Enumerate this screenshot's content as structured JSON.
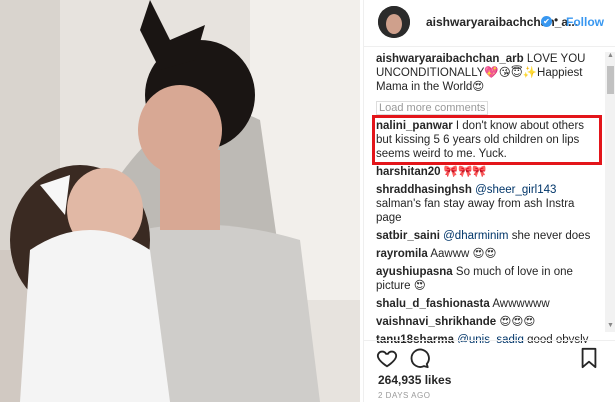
{
  "header": {
    "username": "aishwaryaraibachchan_a...",
    "separator": "•",
    "follow_label": "Follow"
  },
  "comments": [
    {
      "user": "aishwaryaraibachchan_arb",
      "text": "LOVE YOU UNCONDITIONALLY💖😘😇✨Happiest Mama in the World😍"
    },
    {
      "user": "nalini_panwar",
      "text": "I don't know about others but kissing 5 6 years old children on lips seems weird to me. Yuck."
    },
    {
      "user": "harshitan20",
      "text": "🎀🎀🎀"
    },
    {
      "user": "shraddhasinghsh",
      "mention": "@sheer_girl143",
      "text": "salman's fan stay away from ash Instra page"
    },
    {
      "user": "satbir_saini",
      "mention": "@dharminim",
      "text": "she never does"
    },
    {
      "user": "rayromila",
      "text": "Aawww 😍😍"
    },
    {
      "user": "ayushiupasna",
      "text": "So much of love in one picture 😍"
    },
    {
      "user": "shalu_d_fashionasta",
      "text": "Awwwwww"
    },
    {
      "user": "vaishnavi_shrikhande",
      "text": "😍😍😍"
    },
    {
      "user": "tanu18sharma",
      "mention": "@unis_sadiq",
      "text": "good obvsly"
    }
  ],
  "load_more": "Load more comments",
  "likes": "264,935 likes",
  "time_ago": "2 DAYS AGO",
  "icons": [
    "heart-icon",
    "comment-icon",
    "bookmark-icon"
  ],
  "colors": {
    "accent": "#3897f0",
    "highlight": "#e3151a"
  }
}
